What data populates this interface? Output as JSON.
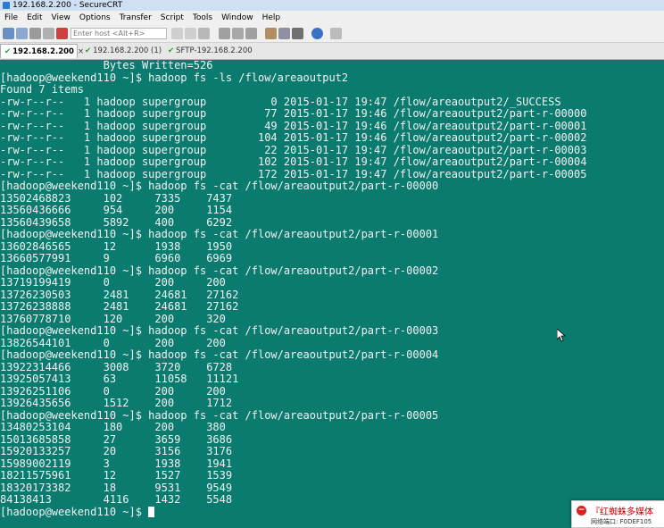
{
  "window": {
    "title": "192.168.2.200 - SecureCRT"
  },
  "menu": [
    "File",
    "Edit",
    "View",
    "Options",
    "Transfer",
    "Script",
    "Tools",
    "Window",
    "Help"
  ],
  "toolbar": {
    "host_placeholder": "Enter host <Alt+R>"
  },
  "tabs": [
    {
      "label": "192.168.2.200",
      "active": true
    },
    {
      "label": "192.168.2.200 (1)",
      "active": false
    },
    {
      "label": "SFTP-192.168.2.200",
      "active": false
    }
  ],
  "terminal": {
    "lines": [
      "                Bytes Written=526",
      "[hadoop@weekend110 ~]$ hadoop fs -ls /flow/areaoutput2",
      "Found 7 items",
      "-rw-r--r--   1 hadoop supergroup          0 2015-01-17 19:47 /flow/areaoutput2/_SUCCESS",
      "-rw-r--r--   1 hadoop supergroup         77 2015-01-17 19:46 /flow/areaoutput2/part-r-00000",
      "-rw-r--r--   1 hadoop supergroup         49 2015-01-17 19:46 /flow/areaoutput2/part-r-00001",
      "-rw-r--r--   1 hadoop supergroup        104 2015-01-17 19:46 /flow/areaoutput2/part-r-00002",
      "-rw-r--r--   1 hadoop supergroup         22 2015-01-17 19:47 /flow/areaoutput2/part-r-00003",
      "-rw-r--r--   1 hadoop supergroup        102 2015-01-17 19:47 /flow/areaoutput2/part-r-00004",
      "-rw-r--r--   1 hadoop supergroup        172 2015-01-17 19:47 /flow/areaoutput2/part-r-00005",
      "[hadoop@weekend110 ~]$ hadoop fs -cat /flow/areaoutput2/part-r-00000",
      "13502468823     102     7335    7437",
      "13560436666     954     200     1154",
      "13560439658     5892    400     6292",
      "[hadoop@weekend110 ~]$ hadoop fs -cat /flow/areaoutput2/part-r-00001",
      "13602846565     12      1938    1950",
      "13660577991     9       6960    6969",
      "[hadoop@weekend110 ~]$ hadoop fs -cat /flow/areaoutput2/part-r-00002",
      "13719199419     0       200     200",
      "13726230503     2481    24681   27162",
      "13726238888     2481    24681   27162",
      "13760778710     120     200     320",
      "[hadoop@weekend110 ~]$ hadoop fs -cat /flow/areaoutput2/part-r-00003",
      "13826544101     0       200     200",
      "[hadoop@weekend110 ~]$ hadoop fs -cat /flow/areaoutput2/part-r-00004",
      "13922314466     3008    3720    6728",
      "13925057413     63      11058   11121",
      "13926251106     0       200     200",
      "13926435656     1512    200     1712",
      "[hadoop@weekend110 ~]$ hadoop fs -cat /flow/areaoutput2/part-r-00005",
      "13480253104     180     200     380",
      "15013685858     27      3659    3686",
      "15920133257     20      3156    3176",
      "15989002119     3       1938    1941",
      "18211575961     12      1527    1539",
      "18320173382     18      9531    9549",
      "84138413        4116    1432    5548"
    ],
    "prompt": "[hadoop@weekend110 ~]$ "
  },
  "notification": {
    "title": "『红蜘蛛多媒体",
    "subtitle": "网络端口: F0DEF105"
  },
  "colors": {
    "terminal_bg": "#0a7b6e",
    "terminal_fg": "#f2f2f2"
  }
}
